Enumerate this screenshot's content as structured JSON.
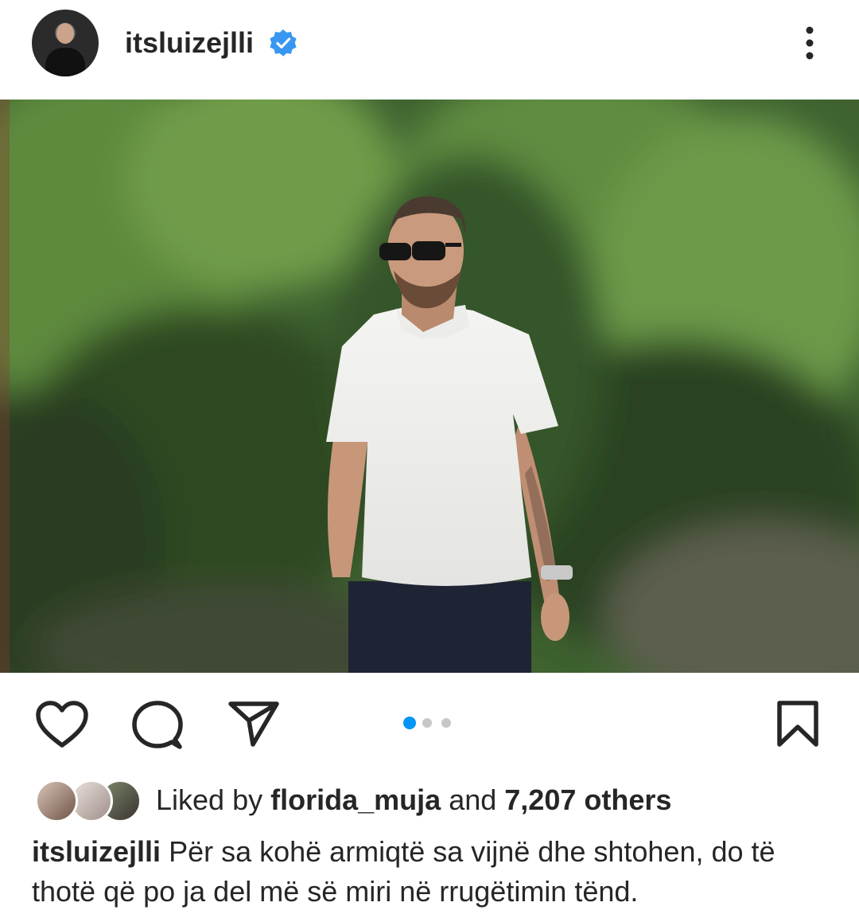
{
  "post": {
    "username": "itsluizejlli",
    "verified": true,
    "more_icon": "more-vertical-icon"
  },
  "actions": {
    "like_icon": "heart-icon",
    "comment_icon": "comment-icon",
    "share_icon": "send-icon",
    "save_icon": "bookmark-icon",
    "carousel": {
      "count": 3,
      "active_index": 0
    }
  },
  "likes": {
    "prefix": "Liked by",
    "liker": "florida_muja",
    "connector": "and",
    "others": "7,207 others"
  },
  "caption": {
    "username": "itsluizejlli",
    "text": "Për sa kohë armiqtë sa vijnë dhe shtohen, do të thotë që po ja del më së miri në rrugëtimin tënd."
  },
  "colors": {
    "verified_blue": "#3897f0",
    "carousel_active": "#0095f6",
    "carousel_inactive": "#c7c7c7",
    "text": "#262626"
  }
}
